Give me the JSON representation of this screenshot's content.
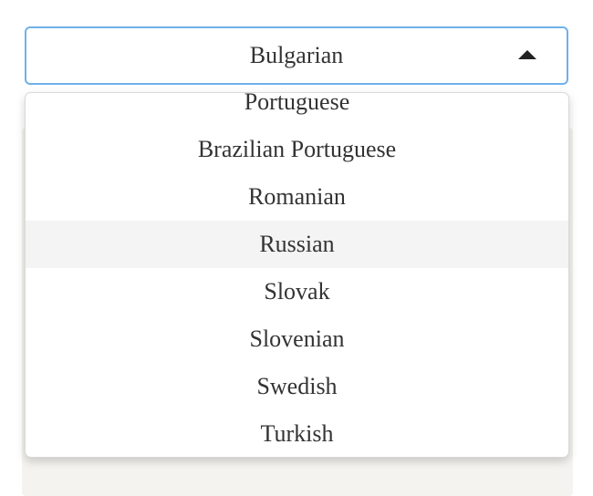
{
  "select": {
    "selected_value": "Bulgarian",
    "caret_icon": "caret-up-icon"
  },
  "dropdown": {
    "options": [
      {
        "label": "Portuguese",
        "highlighted": false
      },
      {
        "label": "Brazilian Portuguese",
        "highlighted": false
      },
      {
        "label": "Romanian",
        "highlighted": false
      },
      {
        "label": "Russian",
        "highlighted": true
      },
      {
        "label": "Slovak",
        "highlighted": false
      },
      {
        "label": "Slovenian",
        "highlighted": false
      },
      {
        "label": "Swedish",
        "highlighted": false
      },
      {
        "label": "Turkish",
        "highlighted": false
      }
    ]
  },
  "colors": {
    "focus_border": "#6fb1ea",
    "highlight_bg": "#f4f4f4",
    "text": "#333333"
  }
}
